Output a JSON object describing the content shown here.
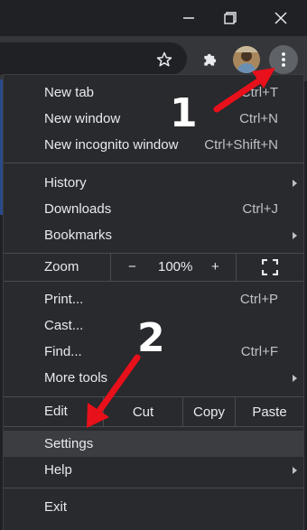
{
  "window": {
    "minimize_icon": "minimize-icon",
    "maximize_icon": "restore-icon",
    "close_icon": "close-icon"
  },
  "toolbar": {
    "bookmark_icon": "star-icon",
    "extensions_icon": "puzzle-icon",
    "menu_icon": "kebab-menu-icon"
  },
  "menu": {
    "new_tab": {
      "label": "New tab",
      "shortcut": "Ctrl+T"
    },
    "new_window": {
      "label": "New window",
      "shortcut": "Ctrl+N"
    },
    "new_incognito": {
      "label": "New incognito window",
      "shortcut": "Ctrl+Shift+N"
    },
    "history": {
      "label": "History"
    },
    "downloads": {
      "label": "Downloads",
      "shortcut": "Ctrl+J"
    },
    "bookmarks": {
      "label": "Bookmarks"
    },
    "zoom": {
      "label": "Zoom",
      "minus": "−",
      "value": "100%",
      "plus": "+"
    },
    "print": {
      "label": "Print...",
      "shortcut": "Ctrl+P"
    },
    "cast": {
      "label": "Cast..."
    },
    "find": {
      "label": "Find...",
      "shortcut": "Ctrl+F"
    },
    "more_tools": {
      "label": "More tools"
    },
    "edit": {
      "label": "Edit",
      "cut": "Cut",
      "copy": "Copy",
      "paste": "Paste"
    },
    "settings": {
      "label": "Settings"
    },
    "help": {
      "label": "Help"
    },
    "exit": {
      "label": "Exit"
    }
  },
  "annotations": {
    "step1": "1",
    "step2": "2",
    "arrow_color": "#e8101a"
  }
}
